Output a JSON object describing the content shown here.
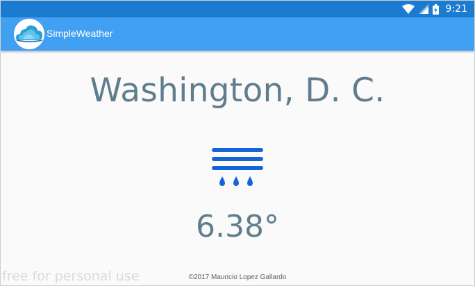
{
  "status_bar": {
    "time": "9:21",
    "icons": [
      "wifi-icon",
      "signal-icon",
      "battery-icon"
    ],
    "color": "#1a7bd0"
  },
  "app_bar": {
    "title": "SimpleWeather",
    "logo_icon": "cloud-logo-icon",
    "color": "#42a0f2"
  },
  "main": {
    "city": "Washington, D. C.",
    "condition_icon": "rain-fog-icon",
    "temperature": "6.38°",
    "text_color": "#5f7d8c",
    "icon_color": "#1565d8"
  },
  "footer": {
    "copyright": "©2017 Mauricio Lopez Gallardo",
    "watermark": "free for personal use"
  }
}
